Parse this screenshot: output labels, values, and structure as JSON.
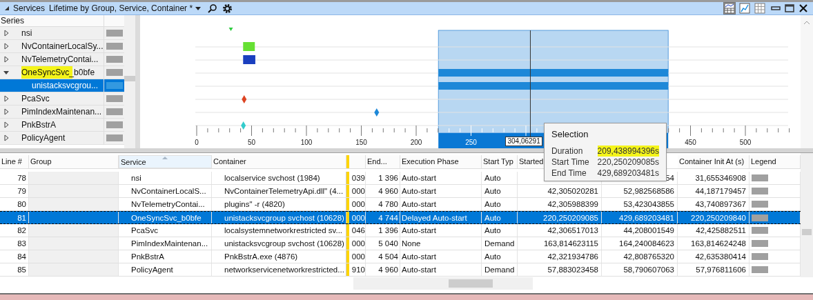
{
  "toolbar": {
    "title": "Services",
    "preset": "Lifetime by Group, Service, Container *",
    "view_buttons": [
      {
        "kind": "graph-table",
        "selected": true
      },
      {
        "kind": "graph",
        "selected": false
      },
      {
        "kind": "table",
        "selected": false
      }
    ]
  },
  "series_panel": {
    "header": "Series",
    "items": [
      {
        "name": "nsi",
        "expanded": false,
        "selected": false,
        "kind": "triangle",
        "color": "#2ecc40"
      },
      {
        "name": "NvContainerLocalSy...",
        "expanded": false,
        "selected": false,
        "kind": "block",
        "color": "#66e033"
      },
      {
        "name": "NvTelemetryContai...",
        "expanded": false,
        "selected": false,
        "kind": "block",
        "color": "#1a3fbf"
      },
      {
        "name": "OneSyncSvc_b0bfe",
        "expanded": true,
        "selected": false,
        "highlighted": true,
        "kind": "bar",
        "color": "#1e88d8",
        "children": [
          {
            "name": "unistacksvcgrou...",
            "selected": true,
            "kind": "bar",
            "color": "#1e88d8"
          }
        ]
      },
      {
        "name": "PcaSvc",
        "expanded": false,
        "selected": false,
        "kind": "diamond",
        "color": "#dd4422"
      },
      {
        "name": "PimIndexMaintenan...",
        "expanded": false,
        "selected": false,
        "kind": "diamond",
        "color": "#1e88d8"
      },
      {
        "name": "PnkBstrA",
        "expanded": false,
        "selected": false,
        "kind": "diamond",
        "color": "#33cccc"
      },
      {
        "name": "PolicyAgent",
        "expanded": false,
        "selected": false
      }
    ]
  },
  "timeline": {
    "axis_labels": [
      "0",
      "50",
      "100",
      "150",
      "200",
      "250",
      "450",
      "500"
    ],
    "cursor": {
      "label": "304,06291"
    }
  },
  "tooltip": {
    "title": "Selection",
    "rows": [
      {
        "label": "Duration",
        "value": "209,438994396s",
        "highlighted": true
      },
      {
        "label": "Start Time",
        "value": "220,250209085s",
        "highlighted": false
      },
      {
        "label": "End Time",
        "value": "429,689203481s",
        "highlighted": false
      }
    ]
  },
  "table": {
    "columns": [
      {
        "label": "Line #"
      },
      {
        "label": "Group"
      },
      {
        "label": "Service",
        "sorted": true
      },
      {
        "label": "Container"
      },
      {
        "kind": "blank"
      },
      {
        "label": "End..."
      },
      {
        "label": "Execution Phase"
      },
      {
        "label": "Start Typ"
      },
      {
        "label": "Started"
      },
      {
        "kind": "hidden"
      },
      {
        "label": "Container Init At (s)"
      },
      {
        "label": "Legend"
      }
    ],
    "rows": [
      {
        "line": "78",
        "service": "nsi",
        "container": "localservice svchost (1984)",
        "col_5": "039",
        "end": "1 396",
        "phase": "Auto-start",
        "start_type": "Auto",
        "col_10": "54",
        "init": "31,655346908",
        "selected": false
      },
      {
        "line": "79",
        "service": "NvContainerLocalS...",
        "container": "NvContainerTelemetryApi.dll\" (4...",
        "col_5": "000",
        "end": "4 960",
        "phase": "Auto-start",
        "start_type": "Auto",
        "started": "42,305020281",
        "col_10": "52,982568586",
        "init": "44,187179457",
        "selected": false
      },
      {
        "line": "80",
        "service": "NvTelemetryContai...",
        "container": "plugins\" -r (4820)",
        "col_5": "000",
        "end": "4 780",
        "phase": "Auto-start",
        "start_type": "Auto",
        "started": "42,305988399",
        "col_10": "53,423043855",
        "init": "43,740897367",
        "selected": false
      },
      {
        "line": "81",
        "service": "OneSyncSvc_b0bfe",
        "container": "unistacksvcgroup svchost (10628)",
        "col_5": "000",
        "end": "4 744",
        "phase": "Delayed Auto-start",
        "start_type": "Auto",
        "started": "220,250209085",
        "col_10": "429,689203481",
        "init": "220,250209840",
        "selected": true
      },
      {
        "line": "82",
        "service": "PcaSvc",
        "container": "localsystemnetworkrestricted sv...",
        "col_5": "046",
        "end": "1 396",
        "phase": "Auto-start",
        "start_type": "Auto",
        "started": "42,306517013",
        "col_10": "44,208001549",
        "init": "42,425882511",
        "selected": false
      },
      {
        "line": "83",
        "service": "PimIndexMaintenan...",
        "container": "unistacksvcgroup svchost (10628)",
        "col_5": "000",
        "end": "5 040",
        "phase": "None",
        "start_type": "Demand",
        "started": "163,814623115",
        "col_10": "164,240084623",
        "init": "163,814624248",
        "selected": false
      },
      {
        "line": "84",
        "service": "PnkBstrA",
        "container": "PnkBstrA.exe (4876)",
        "col_5": "000",
        "end": "4 504",
        "phase": "Auto-start",
        "start_type": "Auto",
        "started": "42,321934786",
        "col_10": "42,808765320",
        "init": "42,635380414",
        "selected": false
      },
      {
        "line": "85",
        "service": "PolicyAgent",
        "container": "networkservicenetworkrestricted...",
        "col_5": "910",
        "end": "4 960",
        "phase": "Auto-start",
        "start_type": "Demand",
        "started": "57,883023458",
        "col_10": "58,790607063",
        "init": "57,976811606",
        "selected": false
      }
    ]
  }
}
